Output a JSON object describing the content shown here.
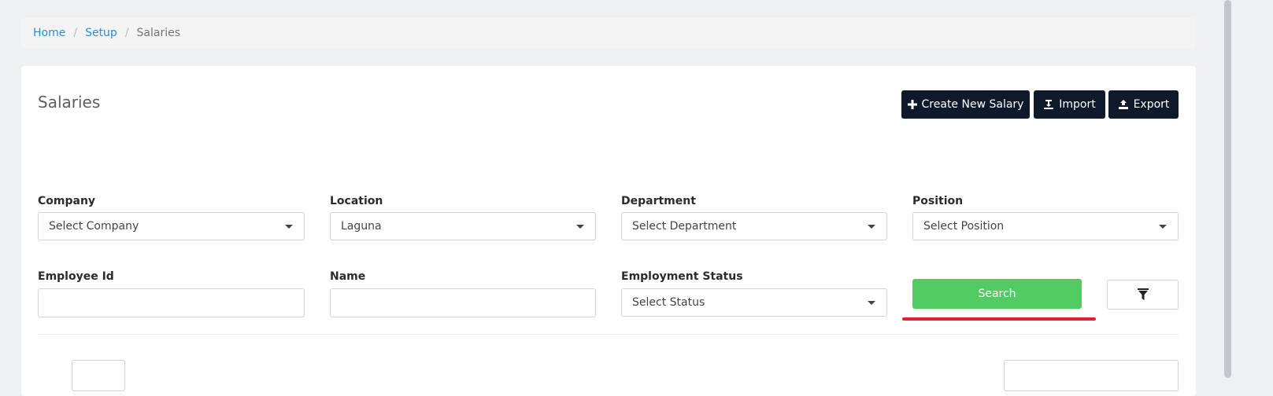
{
  "breadcrumb": {
    "home": "Home",
    "setup": "Setup",
    "current": "Salaries",
    "separator": "/"
  },
  "page": {
    "title": "Salaries"
  },
  "toolbar": {
    "create_label": "Create New Salary",
    "import_label": "Import",
    "export_label": "Export"
  },
  "filters": {
    "company": {
      "label": "Company",
      "value": "Select Company"
    },
    "location": {
      "label": "Location",
      "value": "Laguna"
    },
    "department": {
      "label": "Department",
      "value": "Select Department"
    },
    "position": {
      "label": "Position",
      "value": "Select Position"
    },
    "employee_id": {
      "label": "Employee Id",
      "value": ""
    },
    "name": {
      "label": "Name",
      "value": ""
    },
    "employment_status": {
      "label": "Employment Status",
      "value": "Select Status"
    }
  },
  "actions": {
    "search_label": "Search"
  },
  "colors": {
    "accent_dark": "#0e1a2b",
    "search_green": "#52cc62",
    "link_blue": "#2a8fd1",
    "highlight_red": "#e3202f"
  }
}
